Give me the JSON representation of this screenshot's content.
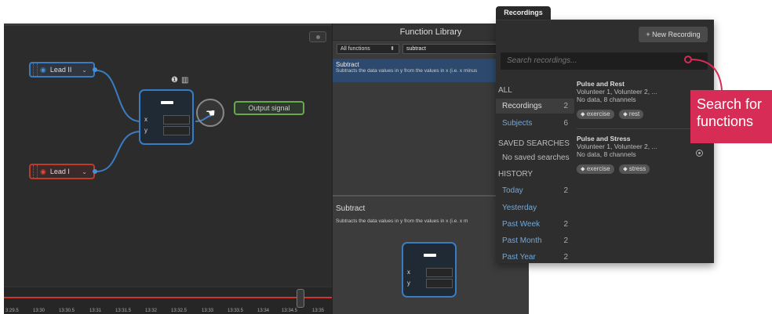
{
  "editor": {
    "input_nodes": [
      {
        "label": "Lead II",
        "color": "#3a7cc2"
      },
      {
        "label": "Lead I",
        "color": "#c0392b"
      }
    ],
    "function_node": {
      "port_x": "x",
      "port_y": "y"
    },
    "output_node": {
      "label": "Output signal"
    },
    "timeline": {
      "ticks": [
        "3:29.5",
        "13:30",
        "13:30.5",
        "13:31",
        "13:31.5",
        "13:32",
        "13:32.5",
        "13:33",
        "13:33.5",
        "13:34",
        "13:34.5",
        "13:35"
      ]
    }
  },
  "function_library": {
    "title": "Function Library",
    "filter_value": "All functions",
    "search_value": "subtract",
    "results": [
      {
        "title": "Subtract",
        "description": "Subtracts the data values in y from the values in x (i.e. x minus"
      }
    ],
    "detail": {
      "title": "Subtract",
      "description": "Subtracts the data values in y from the values in x (i.e. x m",
      "port_x": "x",
      "port_y": "y"
    }
  },
  "recordings": {
    "tab_label": "Recordings",
    "new_button": "+ New Recording",
    "search_placeholder": "Search recordings...",
    "sections": {
      "all": "ALL",
      "saved_searches": "SAVED SEARCHES",
      "history": "HISTORY"
    },
    "all_items": [
      {
        "label": "Recordings",
        "count": "2"
      },
      {
        "label": "Subjects",
        "count": "6"
      }
    ],
    "saved_searches_empty": "No saved searches",
    "history_items": [
      {
        "label": "Today",
        "count": "2"
      },
      {
        "label": "Yesterday",
        "count": ""
      },
      {
        "label": "Past Week",
        "count": "2"
      },
      {
        "label": "Past Month",
        "count": "2"
      },
      {
        "label": "Past Year",
        "count": "2"
      }
    ],
    "list": [
      {
        "title": "Pulse and Rest",
        "subjects": "Volunteer 1, Volunteer 2, ...",
        "meta": "No data, 8 channels",
        "tags": [
          "exercise",
          "rest"
        ]
      },
      {
        "title": "Pulse and Stress",
        "subjects": "Volunteer 1, Volunteer 2, ...",
        "meta": "No data, 8 channels",
        "tags": [
          "exercise",
          "stress"
        ]
      }
    ]
  },
  "callout": {
    "line1": "Search for",
    "line2": "functions",
    "color": "#d62c55"
  }
}
